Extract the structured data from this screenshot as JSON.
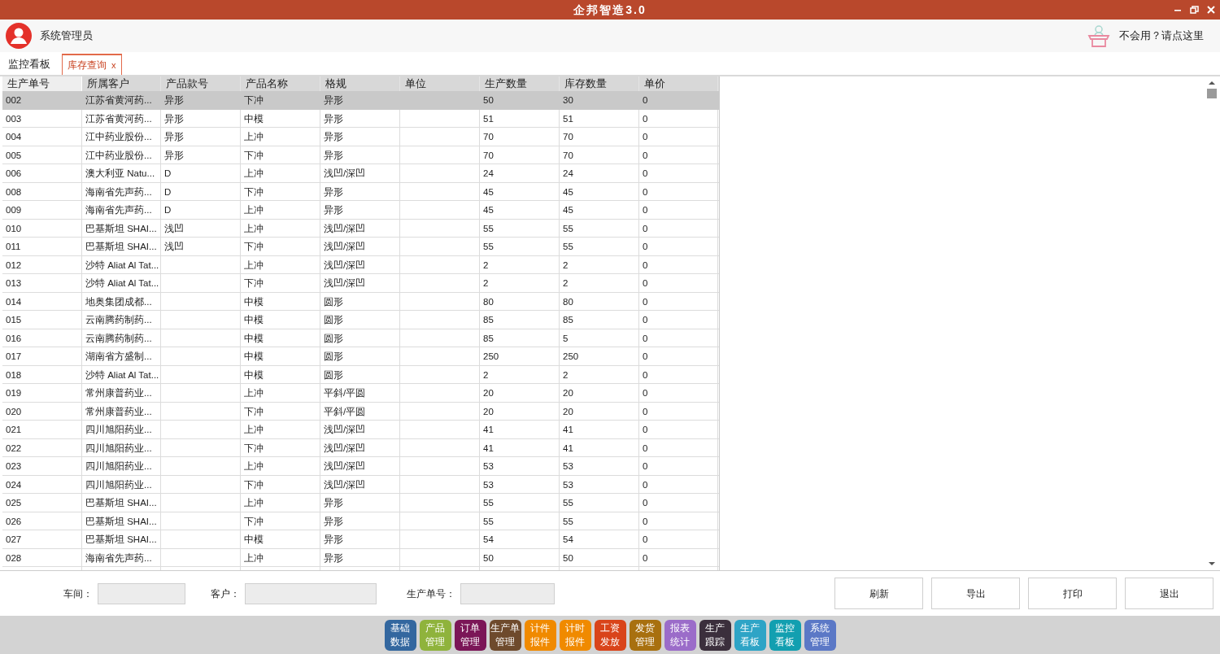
{
  "window": {
    "title": "企邦智造3.0"
  },
  "user": {
    "name": "系统管理员"
  },
  "help": {
    "label": "不会用？请点这里"
  },
  "tabs": [
    {
      "label": "监控看板",
      "selected": false
    },
    {
      "label": "库存查询",
      "selected": true,
      "close": "x"
    }
  ],
  "table": {
    "columns": [
      "生产单号",
      "所属客户",
      "产品款号",
      "产品名称",
      "格规",
      "单位",
      "生产数量",
      "库存数量",
      "单价"
    ],
    "rows": [
      {
        "selected": true,
        "cells": [
          "002",
          "江苏省黄河药...",
          "异形",
          "下冲",
          "异形",
          "",
          "50",
          "30",
          "0"
        ]
      },
      {
        "selected": false,
        "cells": [
          "003",
          "江苏省黄河药...",
          "异形",
          "中模",
          "异形",
          "",
          "51",
          "51",
          "0"
        ]
      },
      {
        "selected": false,
        "cells": [
          "004",
          "江中药业股份...",
          "异形",
          "上冲",
          "异形",
          "",
          "70",
          "70",
          "0"
        ]
      },
      {
        "selected": false,
        "cells": [
          "005",
          "江中药业股份...",
          "异形",
          "下冲",
          "异形",
          "",
          "70",
          "70",
          "0"
        ]
      },
      {
        "selected": false,
        "cells": [
          "006",
          "澳大利亚 Natu...",
          "D",
          "上冲",
          "浅凹/深凹",
          "",
          "24",
          "24",
          "0"
        ]
      },
      {
        "selected": false,
        "cells": [
          "008",
          "海南省先声药...",
          "D",
          "下冲",
          "异形",
          "",
          "45",
          "45",
          "0"
        ]
      },
      {
        "selected": false,
        "cells": [
          "009",
          "海南省先声药...",
          "D",
          "上冲",
          "异形",
          "",
          "45",
          "45",
          "0"
        ]
      },
      {
        "selected": false,
        "cells": [
          "010",
          "巴基斯坦 SHAI...",
          "浅凹",
          "上冲",
          "浅凹/深凹",
          "",
          "55",
          "55",
          "0"
        ]
      },
      {
        "selected": false,
        "cells": [
          "011",
          "巴基斯坦 SHAI...",
          "浅凹",
          "下冲",
          "浅凹/深凹",
          "",
          "55",
          "55",
          "0"
        ]
      },
      {
        "selected": false,
        "cells": [
          "012",
          "沙特 Aliat Al Tat...",
          "",
          "上冲",
          "浅凹/深凹",
          "",
          "2",
          "2",
          "0"
        ]
      },
      {
        "selected": false,
        "cells": [
          "013",
          "沙特 Aliat Al Tat...",
          "",
          "下冲",
          "浅凹/深凹",
          "",
          "2",
          "2",
          "0"
        ]
      },
      {
        "selected": false,
        "cells": [
          "014",
          "地奥集团成都...",
          "",
          "中模",
          "圆形",
          "",
          "80",
          "80",
          "0"
        ]
      },
      {
        "selected": false,
        "cells": [
          "015",
          "云南腾药制药...",
          "",
          "中模",
          "圆形",
          "",
          "85",
          "85",
          "0"
        ]
      },
      {
        "selected": false,
        "cells": [
          "016",
          "云南腾药制药...",
          "",
          "中模",
          "圆形",
          "",
          "85",
          "5",
          "0"
        ]
      },
      {
        "selected": false,
        "cells": [
          "017",
          "湖南省方盛制...",
          "",
          "中模",
          "圆形",
          "",
          "250",
          "250",
          "0"
        ]
      },
      {
        "selected": false,
        "cells": [
          "018",
          "沙特 Aliat Al Tat...",
          "",
          "中模",
          "圆形",
          "",
          "2",
          "2",
          "0"
        ]
      },
      {
        "selected": false,
        "cells": [
          "019",
          "常州康普药业...",
          "",
          "上冲",
          "平斜/平圆",
          "",
          "20",
          "20",
          "0"
        ]
      },
      {
        "selected": false,
        "cells": [
          "020",
          "常州康普药业...",
          "",
          "下冲",
          "平斜/平圆",
          "",
          "20",
          "20",
          "0"
        ]
      },
      {
        "selected": false,
        "cells": [
          "021",
          "四川旭阳药业...",
          "",
          "上冲",
          "浅凹/深凹",
          "",
          "41",
          "41",
          "0"
        ]
      },
      {
        "selected": false,
        "cells": [
          "022",
          "四川旭阳药业...",
          "",
          "下冲",
          "浅凹/深凹",
          "",
          "41",
          "41",
          "0"
        ]
      },
      {
        "selected": false,
        "cells": [
          "023",
          "四川旭阳药业...",
          "",
          "上冲",
          "浅凹/深凹",
          "",
          "53",
          "53",
          "0"
        ]
      },
      {
        "selected": false,
        "cells": [
          "024",
          "四川旭阳药业...",
          "",
          "下冲",
          "浅凹/深凹",
          "",
          "53",
          "53",
          "0"
        ]
      },
      {
        "selected": false,
        "cells": [
          "025",
          "巴基斯坦 SHAI...",
          "",
          "上冲",
          "异形",
          "",
          "55",
          "55",
          "0"
        ]
      },
      {
        "selected": false,
        "cells": [
          "026",
          "巴基斯坦 SHAI...",
          "",
          "下冲",
          "异形",
          "",
          "55",
          "55",
          "0"
        ]
      },
      {
        "selected": false,
        "cells": [
          "027",
          "巴基斯坦 SHAI...",
          "",
          "中模",
          "异形",
          "",
          "54",
          "54",
          "0"
        ]
      },
      {
        "selected": false,
        "cells": [
          "028",
          "海南省先声药...",
          "",
          "上冲",
          "异形",
          "",
          "50",
          "50",
          "0"
        ]
      }
    ]
  },
  "filters": [
    {
      "label": "车间："
    },
    {
      "label": "客户："
    },
    {
      "label": "生产单号："
    }
  ],
  "buttons": [
    "刷新",
    "导出",
    "打印",
    "退出"
  ],
  "modules": [
    {
      "lines": [
        "基础",
        "数据"
      ],
      "color": "#33679f"
    },
    {
      "lines": [
        "产品",
        "管理"
      ],
      "color": "#8fb33c"
    },
    {
      "lines": [
        "订单",
        "管理"
      ],
      "color": "#7b1657"
    },
    {
      "lines": [
        "生产单",
        "管理"
      ],
      "color": "#6e4a2c"
    },
    {
      "lines": [
        "计件",
        "报件"
      ],
      "color": "#f08a00"
    },
    {
      "lines": [
        "计时",
        "报件"
      ],
      "color": "#f08a00"
    },
    {
      "lines": [
        "工资",
        "发放"
      ],
      "color": "#d9441a"
    },
    {
      "lines": [
        "发货",
        "管理"
      ],
      "color": "#a8700f"
    },
    {
      "lines": [
        "报表",
        "统计"
      ],
      "color": "#9b6cc9"
    },
    {
      "lines": [
        "生产",
        "跟踪"
      ],
      "color": "#3b2f3c"
    },
    {
      "lines": [
        "生产",
        "看板"
      ],
      "color": "#2ea4c6"
    },
    {
      "lines": [
        "监控",
        "看板"
      ],
      "color": "#129fb0"
    },
    {
      "lines": [
        "系统",
        "管理"
      ],
      "color": "#5b78c6"
    }
  ]
}
